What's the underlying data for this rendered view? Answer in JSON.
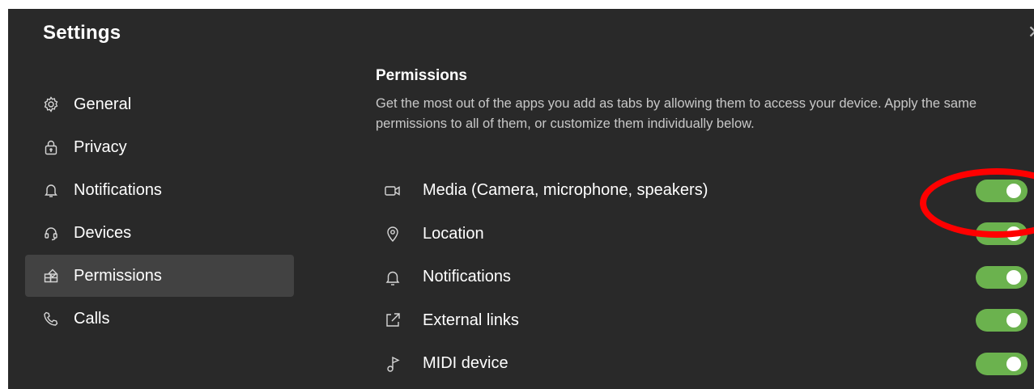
{
  "window": {
    "title": "Settings",
    "close_icon": "close-icon"
  },
  "sidebar": {
    "items": [
      {
        "label": "General",
        "icon": "gear-icon",
        "active": false
      },
      {
        "label": "Privacy",
        "icon": "lock-icon",
        "active": false
      },
      {
        "label": "Notifications",
        "icon": "bell-icon",
        "active": false
      },
      {
        "label": "Devices",
        "icon": "headset-icon",
        "active": false
      },
      {
        "label": "Permissions",
        "icon": "apps-icon",
        "active": true
      },
      {
        "label": "Calls",
        "icon": "phone-icon",
        "active": false
      }
    ]
  },
  "main": {
    "section_title": "Permissions",
    "section_description": "Get the most out of the apps you add as tabs by allowing them to access your device. Apply the same permissions to all of them, or customize them individually below.",
    "permissions": [
      {
        "label": "Media (Camera, microphone, speakers)",
        "icon": "camera-icon",
        "enabled": true
      },
      {
        "label": "Location",
        "icon": "location-icon",
        "enabled": true
      },
      {
        "label": "Notifications",
        "icon": "bell-icon",
        "enabled": true
      },
      {
        "label": "External links",
        "icon": "external-link-icon",
        "enabled": true
      },
      {
        "label": "MIDI device",
        "icon": "music-note-icon",
        "enabled": true
      }
    ]
  },
  "colors": {
    "background": "#292929",
    "active_nav": "#424242",
    "toggle_on": "#6bb24e",
    "annotation": "#ff0000"
  }
}
